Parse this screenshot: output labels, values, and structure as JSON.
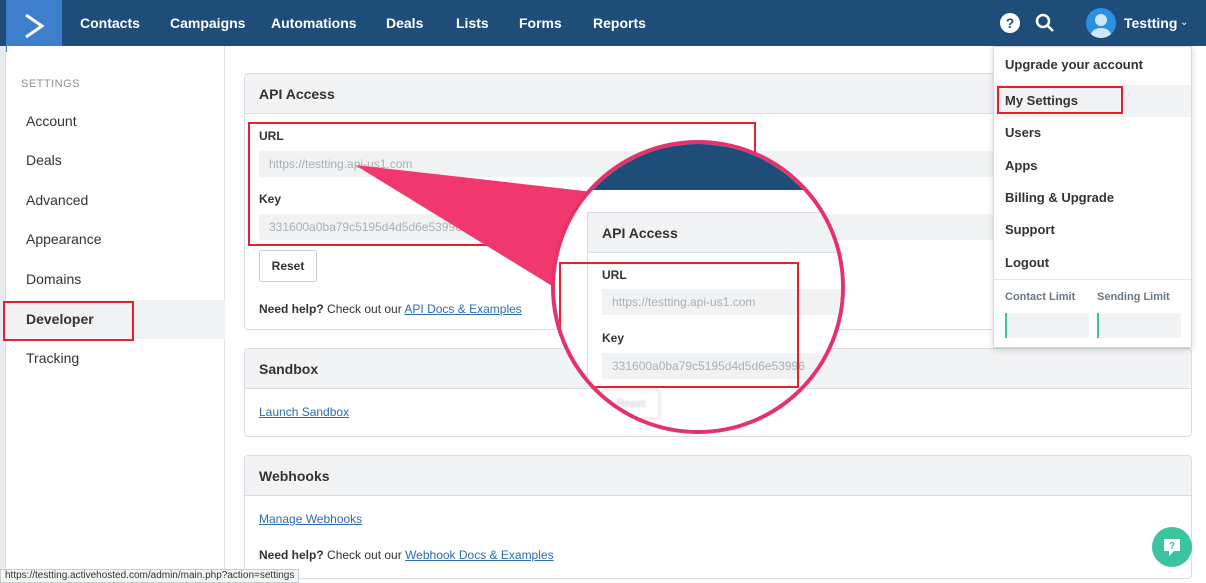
{
  "nav": {
    "items": [
      "Contacts",
      "Campaigns",
      "Automations",
      "Deals",
      "Lists",
      "Forms",
      "Reports"
    ],
    "help_icon": "?",
    "user_name": "Testting",
    "user_chevron": "⌄"
  },
  "sidebar": {
    "heading": "SETTINGS",
    "items": [
      "Account",
      "Deals",
      "Advanced",
      "Appearance",
      "Domains",
      "Developer",
      "Tracking"
    ],
    "active": "Developer"
  },
  "api_access": {
    "title": "API Access",
    "url_label": "URL",
    "url_value": "https://testting.api-us1.com",
    "key_label": "Key",
    "key_value": "331600a0ba79c5195d4d5d6e53996",
    "reset_label": "Reset",
    "help_prefix": "Need help?",
    "help_text": " Check out our ",
    "help_link": "API Docs & Examples"
  },
  "sandbox": {
    "title": "Sandbox",
    "link": "Launch Sandbox"
  },
  "webhooks": {
    "title": "Webhooks",
    "link": "Manage Webhooks",
    "help_prefix": "Need help?",
    "help_text": " Check out our ",
    "help_link": "Webhook Docs & Examples"
  },
  "dropdown": {
    "items": [
      "Upgrade your account",
      "My Settings",
      "Users",
      "Apps",
      "Billing & Upgrade",
      "Support",
      "Logout"
    ],
    "contact_limit_label": "Contact Limit",
    "sending_limit_label": "Sending Limit"
  },
  "magnifier": {
    "title": "API Access",
    "url_label": "URL",
    "url_value": "https://testting.api-us1.com",
    "key_label": "Key",
    "key_value": "331600a0ba79c5195d4d5d6e53996",
    "reset_label": "Reset"
  },
  "statusbar": {
    "url": "https://testting.activehosted.com/admin/main.php?action=settings"
  },
  "colors": {
    "nav_bg": "#1f4d7a",
    "logo_bg": "#3d7fcc",
    "annotation_red": "#e5202f",
    "callout_pink": "#e5336a",
    "accent_green": "#3cc4a0",
    "link_blue": "#2b6cb0"
  }
}
